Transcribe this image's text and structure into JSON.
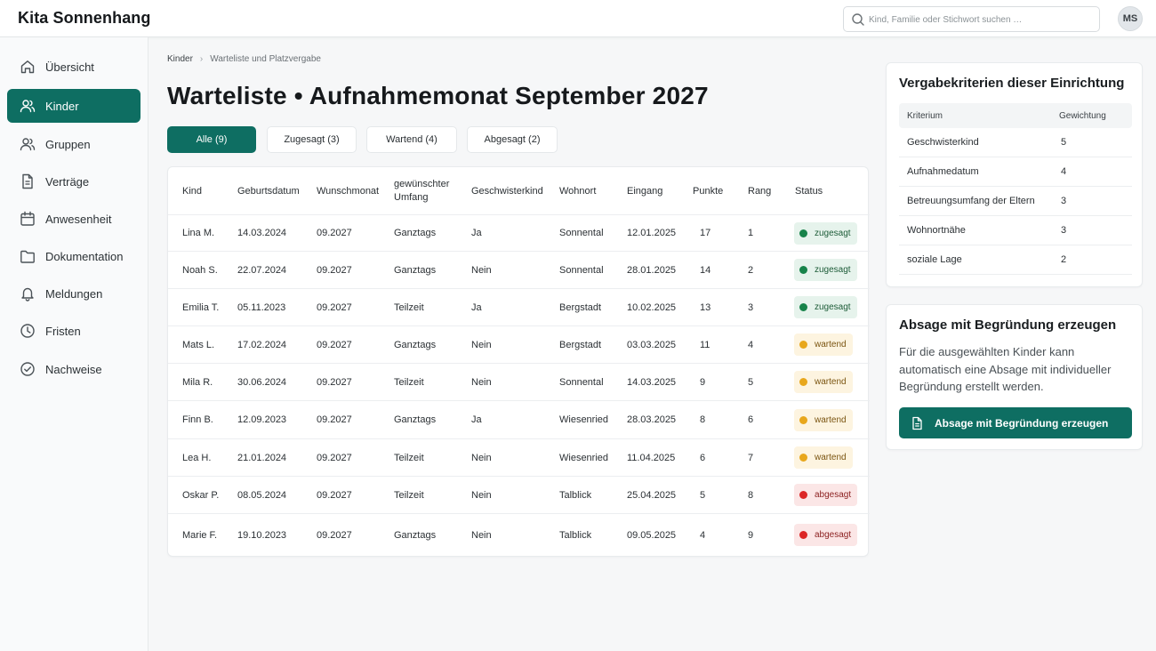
{
  "app": {
    "title": "Kita Sonnenhang"
  },
  "header": {
    "search_placeholder": "Kind, Familie oder Stichwort suchen …",
    "avatar_initials": "MS"
  },
  "sidebar": {
    "items": [
      {
        "label": "Übersicht",
        "icon": "home-icon",
        "active": false
      },
      {
        "label": "Kinder",
        "icon": "users-icon",
        "active": true
      },
      {
        "label": "Gruppen",
        "icon": "group-icon",
        "active": false
      },
      {
        "label": "Verträge",
        "icon": "document-icon",
        "active": false
      },
      {
        "label": "Anwesenheit",
        "icon": "calendar-icon",
        "active": false
      },
      {
        "label": "Dokumentation",
        "icon": "folder-icon",
        "active": false
      },
      {
        "label": "Meldungen",
        "icon": "bell-icon",
        "active": false
      },
      {
        "label": "Fristen",
        "icon": "clock-icon",
        "active": false
      },
      {
        "label": "Nachweise",
        "icon": "check-circle-icon",
        "active": false
      }
    ]
  },
  "breadcrumb": {
    "parent": "Kinder",
    "current": "Warteliste und Platzvergabe"
  },
  "page": {
    "title": "Warteliste • Aufnahmemonat September 2027"
  },
  "filters": [
    {
      "label": "Alle (9)",
      "active": true
    },
    {
      "label": "Zugesagt (3)",
      "active": false
    },
    {
      "label": "Wartend (4)",
      "active": false
    },
    {
      "label": "Abgesagt (2)",
      "active": false
    }
  ],
  "table": {
    "headers": {
      "kind": "Kind",
      "geburtsdatum": "Geburtsdatum",
      "wunschmonat": "Wunschmonat",
      "umfang_line1": "gewünschter",
      "umfang_line2": "Umfang",
      "geschwister": "Geschwisterkind",
      "wohnort": "Wohnort",
      "eingang": "Eingang",
      "punkte": "Punkte",
      "rang": "Rang",
      "status": "Status"
    },
    "rows": [
      {
        "kind": "Lina M.",
        "geburtsdatum": "14.03.2024",
        "wunschmonat": "09.2027",
        "umfang": "Ganztags",
        "geschwister": "Ja",
        "wohnort": "Sonnental",
        "eingang": "12.01.2025",
        "punkte": "17",
        "rang": "1",
        "status": "zugesagt"
      },
      {
        "kind": "Noah S.",
        "geburtsdatum": "22.07.2024",
        "wunschmonat": "09.2027",
        "umfang": "Ganztags",
        "geschwister": "Nein",
        "wohnort": "Sonnental",
        "eingang": "28.01.2025",
        "punkte": "14",
        "rang": "2",
        "status": "zugesagt"
      },
      {
        "kind": "Emilia T.",
        "geburtsdatum": "05.11.2023",
        "wunschmonat": "09.2027",
        "umfang": "Teilzeit",
        "geschwister": "Ja",
        "wohnort": "Bergstadt",
        "eingang": "10.02.2025",
        "punkte": "13",
        "rang": "3",
        "status": "zugesagt"
      },
      {
        "kind": "Mats L.",
        "geburtsdatum": "17.02.2024",
        "wunschmonat": "09.2027",
        "umfang": "Ganztags",
        "geschwister": "Nein",
        "wohnort": "Bergstadt",
        "eingang": "03.03.2025",
        "punkte": "11",
        "rang": "4",
        "status": "wartend"
      },
      {
        "kind": "Mila R.",
        "geburtsdatum": "30.06.2024",
        "wunschmonat": "09.2027",
        "umfang": "Teilzeit",
        "geschwister": "Nein",
        "wohnort": "Sonnental",
        "eingang": "14.03.2025",
        "punkte": "9",
        "rang": "5",
        "status": "wartend"
      },
      {
        "kind": "Finn B.",
        "geburtsdatum": "12.09.2023",
        "wunschmonat": "09.2027",
        "umfang": "Ganztags",
        "geschwister": "Ja",
        "wohnort": "Wiesenried",
        "eingang": "28.03.2025",
        "punkte": "8",
        "rang": "6",
        "status": "wartend"
      },
      {
        "kind": "Lea H.",
        "geburtsdatum": "21.01.2024",
        "wunschmonat": "09.2027",
        "umfang": "Teilzeit",
        "geschwister": "Nein",
        "wohnort": "Wiesenried",
        "eingang": "11.04.2025",
        "punkte": "6",
        "rang": "7",
        "status": "wartend"
      },
      {
        "kind": "Oskar P.",
        "geburtsdatum": "08.05.2024",
        "wunschmonat": "09.2027",
        "umfang": "Teilzeit",
        "geschwister": "Nein",
        "wohnort": "Talblick",
        "eingang": "25.04.2025",
        "punkte": "5",
        "rang": "8",
        "status": "abgesagt"
      },
      {
        "kind": "Marie F.",
        "geburtsdatum": "19.10.2023",
        "wunschmonat": "09.2027",
        "umfang": "Ganztags",
        "geschwister": "Nein",
        "wohnort": "Talblick",
        "eingang": "09.05.2025",
        "punkte": "4",
        "rang": "9",
        "status": "abgesagt"
      }
    ]
  },
  "criteria": {
    "title": "Vergabekriterien dieser Einrichtung",
    "col_criterion": "Kriterium",
    "col_weight": "Gewichtung",
    "rows": [
      {
        "name": "Geschwisterkind",
        "weight": "5"
      },
      {
        "name": "Aufnahmedatum",
        "weight": "4"
      },
      {
        "name": "Betreuungsumfang der Eltern",
        "weight": "3"
      },
      {
        "name": "Wohnortnähe",
        "weight": "3"
      },
      {
        "name": "soziale Lage",
        "weight": "2"
      }
    ]
  },
  "rejection": {
    "title": "Absage mit Begründung erzeugen",
    "description": "Für die ausgewählten Kinder kann automatisch eine Absage mit individueller Begründung erstellt werden.",
    "button_label": "Absage mit Begründung erzeugen",
    "button_icon": "document-icon"
  },
  "colors": {
    "accent": "#0e6e62",
    "zugesagt": "#17834a",
    "wartend": "#e8a71c",
    "abgesagt": "#dc2626"
  }
}
